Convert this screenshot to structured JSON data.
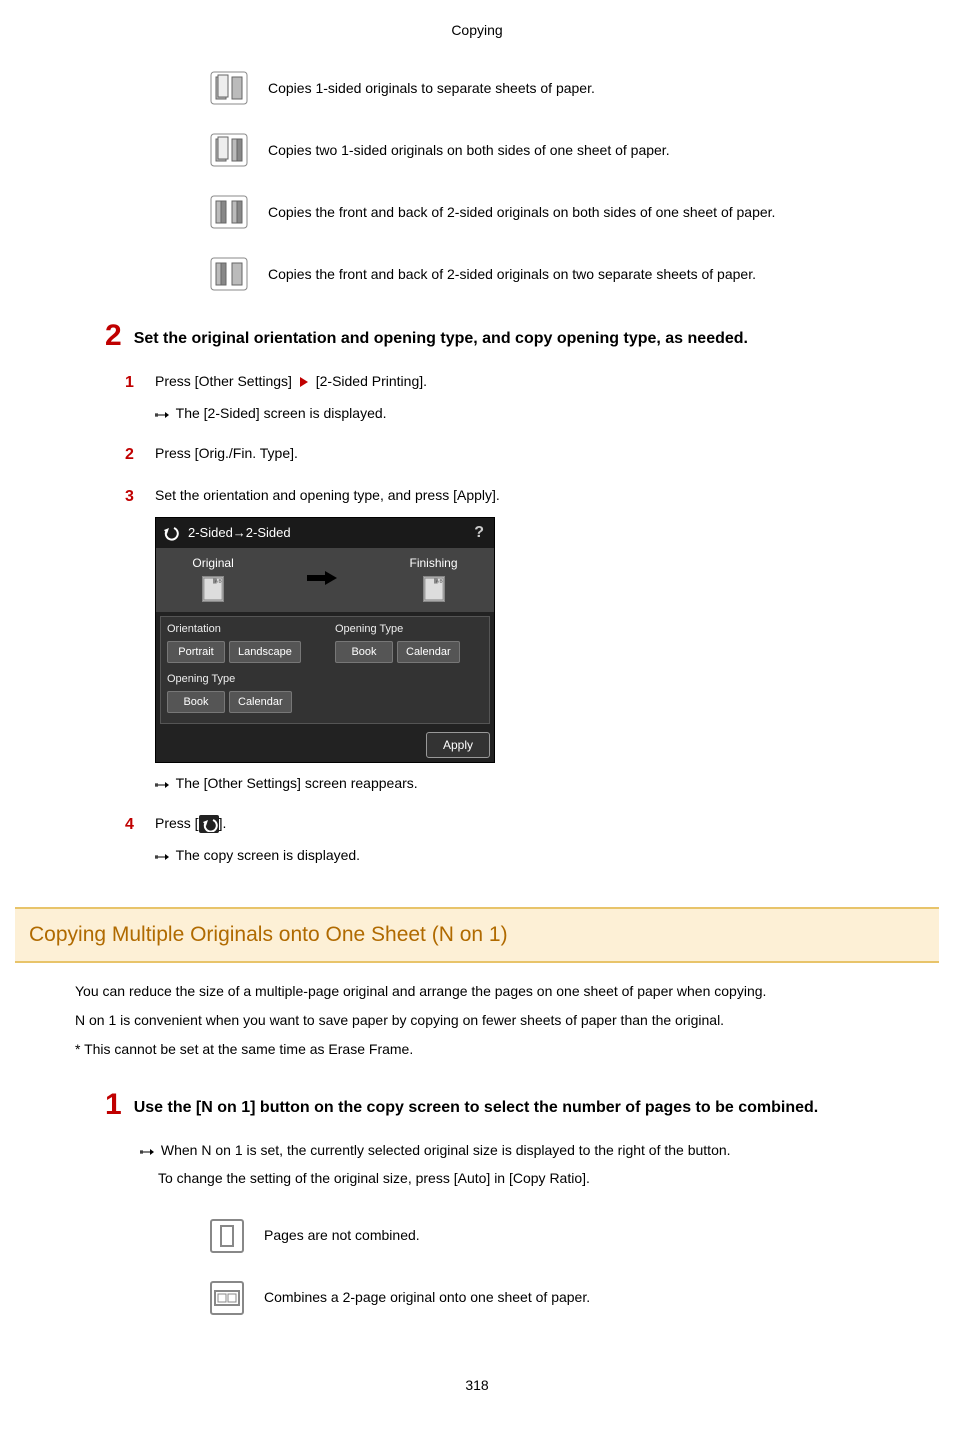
{
  "page_header": "Copying",
  "icon_rows_top": [
    {
      "desc": "Copies 1-sided originals to separate sheets of paper."
    },
    {
      "desc": "Copies two 1-sided originals on both sides of one sheet of paper."
    },
    {
      "desc": "Copies the front and back of 2-sided originals on both sides of one sheet of paper."
    },
    {
      "desc": "Copies the front and back of 2-sided originals on two separate sheets of paper."
    }
  ],
  "step2": {
    "num": "2",
    "title": "Set the original orientation and opening type, and copy opening type, as needed."
  },
  "sub1": {
    "num": "1",
    "text_pre": "Press [Other Settings] ",
    "text_post": " [2-Sided Printing].",
    "result": "The [2-Sided] screen is displayed."
  },
  "sub2": {
    "num": "2",
    "text": "Press [Orig./Fin. Type]."
  },
  "sub3": {
    "num": "3",
    "text": "Set the orientation and opening type, and press [Apply].",
    "result": "The [Other Settings] screen reappears."
  },
  "screenshot": {
    "title": "2-Sided→2-Sided",
    "help": "?",
    "col1": "Original",
    "col2": "Finishing",
    "orientation_label": "Orientation",
    "portrait": "Portrait",
    "landscape": "Landscape",
    "opening_label_left": "Opening Type",
    "book_left": "Book",
    "calendar_left": "Calendar",
    "opening_label_right": "Opening Type",
    "book_right": "Book",
    "calendar_right": "Calendar",
    "apply": "Apply"
  },
  "sub4": {
    "num": "4",
    "text_pre": "Press [",
    "text_post": "].",
    "result": "The copy screen is displayed."
  },
  "section_heading": "Copying Multiple Originals onto One Sheet (N on 1)",
  "section_para1": "You can reduce the size of a multiple-page original and arrange the pages on one sheet of paper when copying.",
  "section_para2": "N on 1 is convenient when you want to save paper by copying on fewer sheets of paper than the original.",
  "section_para3": "* This cannot be set at the same time as Erase Frame.",
  "step1b": {
    "num": "1",
    "title": "Use the [N on 1] button on the copy screen to select the number of pages to be combined.",
    "note1": "When N on 1 is set, the currently selected original size is displayed to the right of the button.",
    "note2": "To change the setting of the original size, press [Auto] in [Copy Ratio]."
  },
  "icon_rows_bottom": [
    {
      "desc": "Pages are not combined."
    },
    {
      "desc": "Combines a 2-page original onto one sheet of paper."
    }
  ],
  "page_number": "318"
}
